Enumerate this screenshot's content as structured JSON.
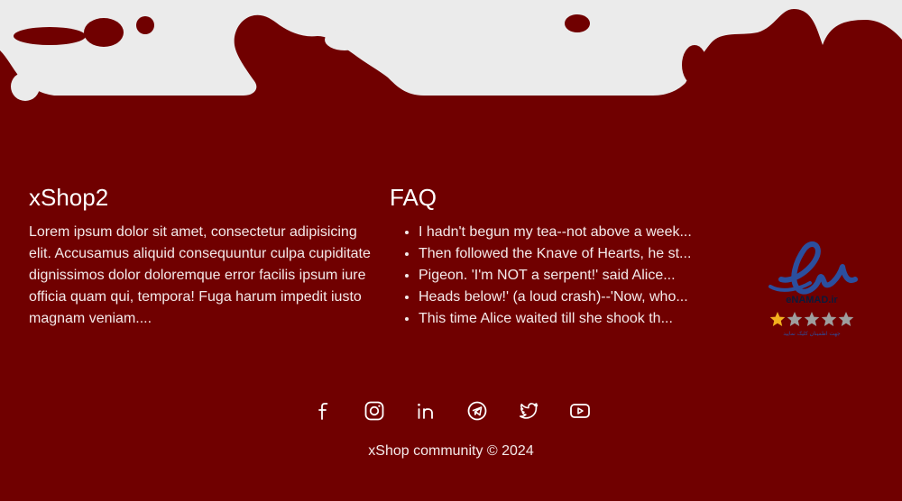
{
  "about": {
    "title": "xShop2",
    "text": "Lorem ipsum dolor sit amet, consectetur adipisicing elit. Accusamus aliquid consequuntur culpa cupiditate dignissimos dolor doloremque error facilis ipsum iure officia quam qui, tempora! Fuga harum impedit iusto magnam veniam...."
  },
  "faq": {
    "title": "FAQ",
    "items": [
      "I hadn't begun my tea--not above a week...",
      "Then followed the Knave of Hearts, he st...",
      "Pigeon. 'I'm NOT a serpent!' said Alice...",
      "Heads below!' (a loud crash)--'Now, who...",
      "This time Alice waited till she shook th..."
    ]
  },
  "badge": {
    "brand": "eNAMAD.ir",
    "caption": "جهت اطمینان کلیک نمایید",
    "stars_filled": 1,
    "stars_total": 5
  },
  "socials": [
    {
      "name": "facebook-icon"
    },
    {
      "name": "instagram-icon"
    },
    {
      "name": "linkedin-icon"
    },
    {
      "name": "telegram-icon"
    },
    {
      "name": "twitter-icon"
    },
    {
      "name": "youtube-icon"
    }
  ],
  "copyright": "xShop community © 2024",
  "colors": {
    "background": "#700000",
    "top_wave": "#ebebeb",
    "badge_blue": "#2b4f9e",
    "star_gold": "#f2b01e",
    "star_gray": "#9e9e9e"
  }
}
